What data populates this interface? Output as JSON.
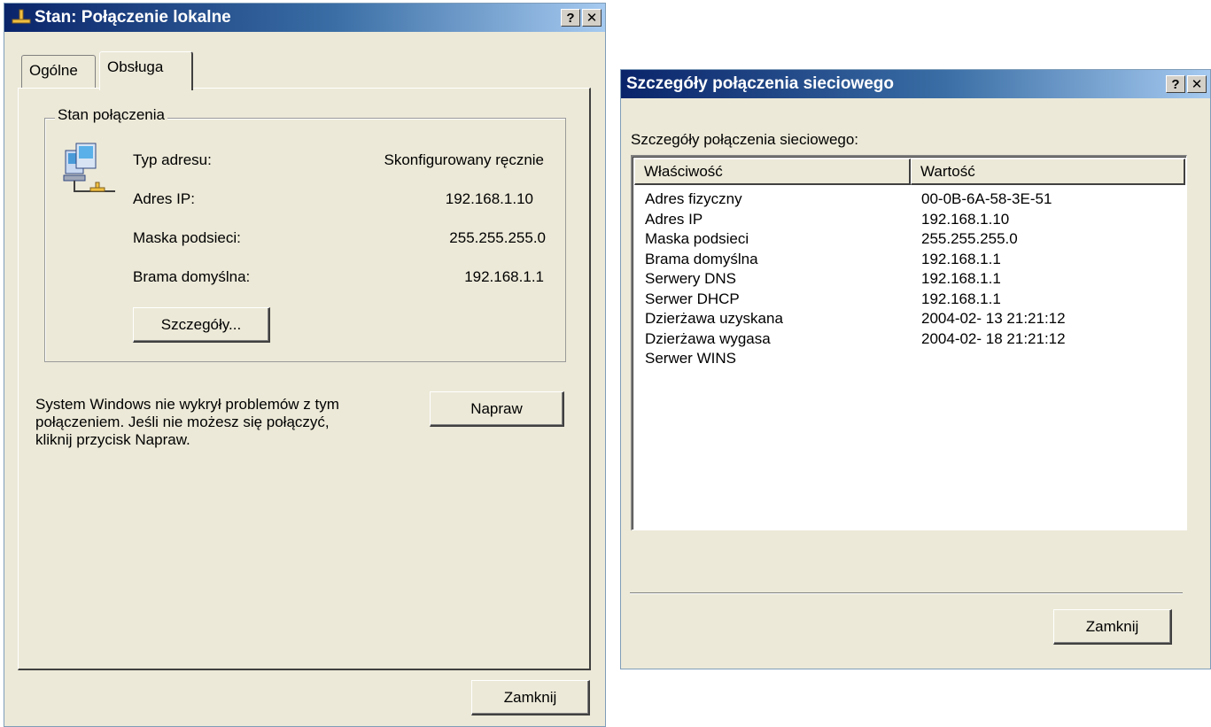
{
  "dialog1": {
    "title": "Stan: Połączenie lokalne",
    "help_label": "?",
    "close_label": "✕",
    "tabs": [
      {
        "label": "Ogólne",
        "active": false
      },
      {
        "label": "Obsługa",
        "active": true
      }
    ],
    "group_label": "Stan połączenia",
    "fields": [
      {
        "label": "Typ adresu:",
        "value": "Skonfigurowany ręcznie"
      },
      {
        "label": "Adres IP:",
        "value": "192.168.1.10"
      },
      {
        "label": "Maska podsieci:",
        "value": "255.255.255.0"
      },
      {
        "label": "Brama domyślna:",
        "value": "192.168.1.1"
      }
    ],
    "details_button": "Szczegóły...",
    "repair_text": [
      "System Windows nie wykrył problemów z tym",
      "połączeniem. Jeśli nie możesz się połączyć,",
      "kliknij przycisk Napraw."
    ],
    "repair_button": "Napraw",
    "close_button": "Zamknij"
  },
  "dialog2": {
    "title": "Szczegóły połączenia sieciowego",
    "help_label": "?",
    "close_label": "✕",
    "list_caption": "Szczegóły połączenia sieciowego:",
    "columns": [
      "Właściwość",
      "Wartość"
    ],
    "rows": [
      [
        "Adres fizyczny",
        "00-0B-6A-58-3E-51"
      ],
      [
        "Adres IP",
        "192.168.1.10"
      ],
      [
        "Maska podsieci",
        "255.255.255.0"
      ],
      [
        "Brama domyślna",
        "192.168.1.1"
      ],
      [
        "Serwery DNS",
        "192.168.1.1"
      ],
      [
        "Serwer DHCP",
        "192.168.1.1"
      ],
      [
        "Dzierżawa uzyskana",
        "2004-02- 13 21:21:12"
      ],
      [
        "Dzierżawa wygasa",
        "2004-02- 18 21:21:12"
      ],
      [
        "Serwer WINS",
        ""
      ]
    ],
    "close_button": "Zamknij"
  },
  "icons": {
    "title_icon": "network-connection-icon",
    "group_icon": "network-computers-icon"
  }
}
